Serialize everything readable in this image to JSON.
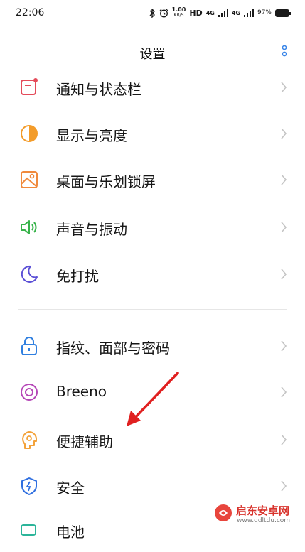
{
  "status_bar": {
    "time": "22:06",
    "speed_value": "1.00",
    "speed_unit": "KB/S",
    "hd": "HD",
    "network1": "4G",
    "network2": "4G",
    "battery_percent": "97%",
    "icons": [
      "bluetooth-icon",
      "alarm-icon",
      "signal-icon",
      "battery-icon"
    ]
  },
  "header": {
    "title": "设置"
  },
  "settings": {
    "items": [
      {
        "label": "通知与状态栏",
        "icon": "notification-icon",
        "color": "#e44b5a"
      },
      {
        "label": "显示与亮度",
        "icon": "display-icon",
        "color": "#f39c2b"
      },
      {
        "label": "桌面与乐划锁屏",
        "icon": "wallpaper-icon",
        "color": "#f08a3c"
      },
      {
        "label": "声音与振动",
        "icon": "speaker-icon",
        "color": "#37b34a"
      },
      {
        "label": "免打扰",
        "icon": "moon-icon",
        "color": "#5b4fd6"
      },
      {
        "label": "指纹、面部与密码",
        "icon": "lock-icon",
        "color": "#2f7fe0"
      },
      {
        "label": "Breeno",
        "icon": "breeno-icon",
        "color": "#b648b8"
      },
      {
        "label": "便捷辅助",
        "icon": "assist-icon",
        "color": "#f3a23a"
      },
      {
        "label": "安全",
        "icon": "shield-icon",
        "color": "#2f6fe0"
      },
      {
        "label": "电池",
        "icon": "battery-icon",
        "color": "#2bb59a"
      }
    ]
  },
  "watermark": {
    "name": "启东安卓网",
    "url": "www.qdltdu.com"
  },
  "colors": {
    "chevron": "#c4c4c4",
    "arrow": "#e02020",
    "more": "#3a86e8"
  }
}
